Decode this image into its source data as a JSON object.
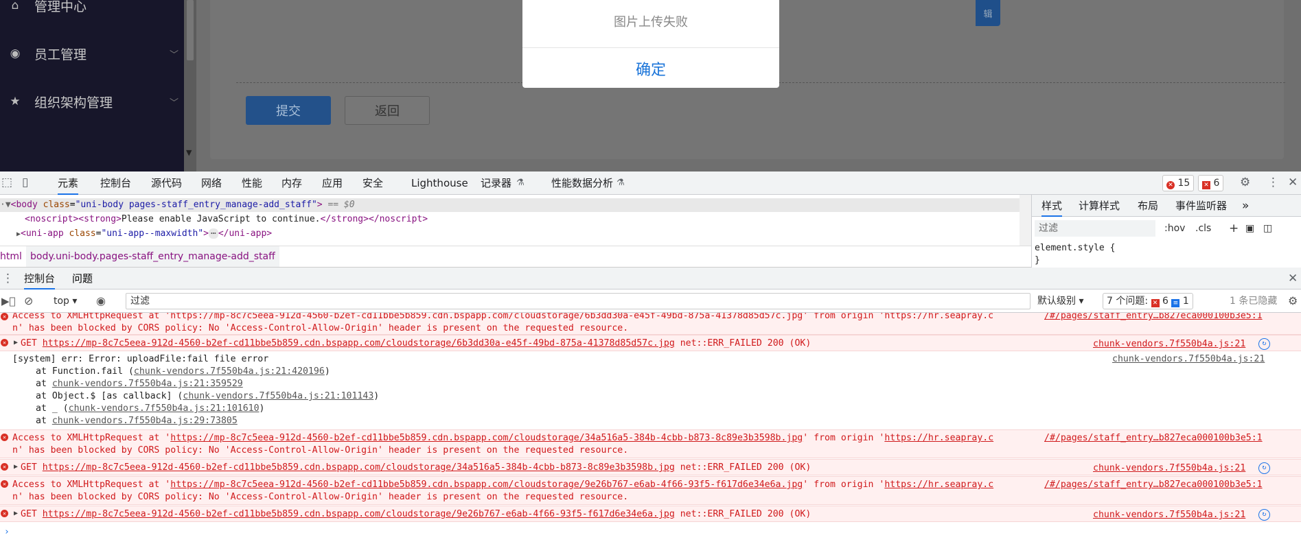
{
  "sidebar": {
    "items": [
      {
        "label": "管理中心",
        "icon": "home-icon"
      },
      {
        "label": "员工管理",
        "icon": "user-icon"
      },
      {
        "label": "组织架构管理",
        "icon": "star-icon"
      }
    ]
  },
  "page": {
    "top_button_label": "辑",
    "submit_label": "提交",
    "back_label": "返回"
  },
  "modal": {
    "message": "图片上传失败",
    "confirm_label": "确定"
  },
  "devtools": {
    "tabs": [
      "元素",
      "控制台",
      "源代码",
      "网络",
      "性能",
      "内存",
      "应用",
      "安全",
      "Lighthouse",
      "记录器",
      "性能数据分析"
    ],
    "error_count": "15",
    "warning_count": "6",
    "elements": {
      "body_tag_open": "<body",
      "body_class_attr": "class",
      "body_class_value": "\"uni-body pages-staff_entry_manage-add_staff\"",
      "body_tag_close": ">",
      "body_marker": "== $0",
      "noscript_open": "<noscript>",
      "strong_open": "<strong>",
      "noscript_text": "Please enable JavaScript to continue.",
      "strong_close": "</strong>",
      "noscript_close": "</noscript>",
      "uniapp_open": "<uni-app",
      "uniapp_class_attr": "class",
      "uniapp_class_value": "\"uni-app--maxwidth\"",
      "uniapp_gt": ">",
      "uniapp_ellipsis": "⋯",
      "uniapp_close": "</uni-app>"
    },
    "breadcrumb": {
      "html": "html",
      "body": "body.uni-body.pages-staff_entry_manage-add_staff"
    },
    "styles": {
      "tabs": [
        "样式",
        "计算样式",
        "布局",
        "事件监听器"
      ],
      "more": "»",
      "filter_placeholder": "过滤",
      "hov": ":hov",
      "cls": ".cls",
      "element_style": "element.style {",
      "close_brace": "}"
    },
    "console_tabs": [
      "控制台",
      "问题"
    ],
    "console_toolbar": {
      "context": "top",
      "filter_placeholder": "过滤",
      "level": "默认级别",
      "issues_label": "7 个问题:",
      "issues_errors": "6",
      "issues_info": "1",
      "hidden": "1 条已隐藏"
    },
    "messages": {
      "m0_l1": "Access to XMLHttpRequest at 'https://mp-8c7c5eea-912d-4560-b2ef-cd11bbe5b859.cdn.bspapp.com/cloudstorage/6b3dd30a-e45f-49bd-875a-41378d85d57c.jpg' from origin 'https://hr.seapray.c",
      "m0_l2": "n' has been blocked by CORS policy: No 'Access-Control-Allow-Origin' header is present on the requested resource.",
      "m0_src": "/#/pages/staff_entry…b827eca000100b3e5:1",
      "g1_get": "GET",
      "g1_url": "https://mp-8c7c5eea-912d-4560-b2ef-cd11bbe5b859.cdn.bspapp.com/cloudstorage/6b3dd30a-e45f-49bd-875a-41378d85d57c.jpg",
      "g1_err": "net::ERR_FAILED 200 (OK)",
      "g1_src": "chunk-vendors.7f550b4a.js:21",
      "sys_l1": "[system] err:  Error: uploadFile:fail file error",
      "sys_l2a": "at Function.fail (",
      "sys_l2b": "chunk-vendors.7f550b4a.js:21:420196",
      "sys_l2c": ")",
      "sys_l3a": "at ",
      "sys_l3b": "chunk-vendors.7f550b4a.js:21:359529",
      "sys_l4a": "at Object.$ [as callback] (",
      "sys_l4b": "chunk-vendors.7f550b4a.js:21:101143",
      "sys_l4c": ")",
      "sys_l5a": "at _ (",
      "sys_l5b": "chunk-vendors.7f550b4a.js:21:101610",
      "sys_l5c": ")",
      "sys_l6a": "at ",
      "sys_l6b": "chunk-vendors.7f550b4a.js:29:73805",
      "sys_src": "chunk-vendors.7f550b4a.js:21",
      "m2_pre": "Access to XMLHttpRequest at '",
      "m2_url": "https://mp-8c7c5eea-912d-4560-b2ef-cd11bbe5b859.cdn.bspapp.com/cloudstorage/34a516a5-384b-4cbb-b873-8c89e3b3598b.jpg",
      "m2_mid": "' from origin '",
      "m2_origin": "https://hr.seapray.c",
      "m2_l2": "n' has been blocked by CORS policy: No 'Access-Control-Allow-Origin' header is present on the requested resource.",
      "m2_src": "/#/pages/staff_entry…b827eca000100b3e5:1",
      "g3_get": "GET",
      "g3_url": "https://mp-8c7c5eea-912d-4560-b2ef-cd11bbe5b859.cdn.bspapp.com/cloudstorage/34a516a5-384b-4cbb-b873-8c89e3b3598b.jpg",
      "g3_err": "net::ERR_FAILED 200 (OK)",
      "g3_src": "chunk-vendors.7f550b4a.js:21",
      "m4_pre": "Access to XMLHttpRequest at '",
      "m4_url": "https://mp-8c7c5eea-912d-4560-b2ef-cd11bbe5b859.cdn.bspapp.com/cloudstorage/9e26b767-e6ab-4f66-93f5-f617d6e34e6a.jpg",
      "m4_mid": "' from origin '",
      "m4_origin": "https://hr.seapray.c",
      "m4_l2": "n' has been blocked by CORS policy: No 'Access-Control-Allow-Origin' header is present on the requested resource.",
      "m4_src": "/#/pages/staff_entry…b827eca000100b3e5:1",
      "g5_get": "GET",
      "g5_url": "https://mp-8c7c5eea-912d-4560-b2ef-cd11bbe5b859.cdn.bspapp.com/cloudstorage/9e26b767-e6ab-4f66-93f5-f617d6e34e6a.jpg",
      "g5_err": "net::ERR_FAILED 200 (OK)",
      "g5_src": "chunk-vendors.7f550b4a.js:21"
    }
  }
}
